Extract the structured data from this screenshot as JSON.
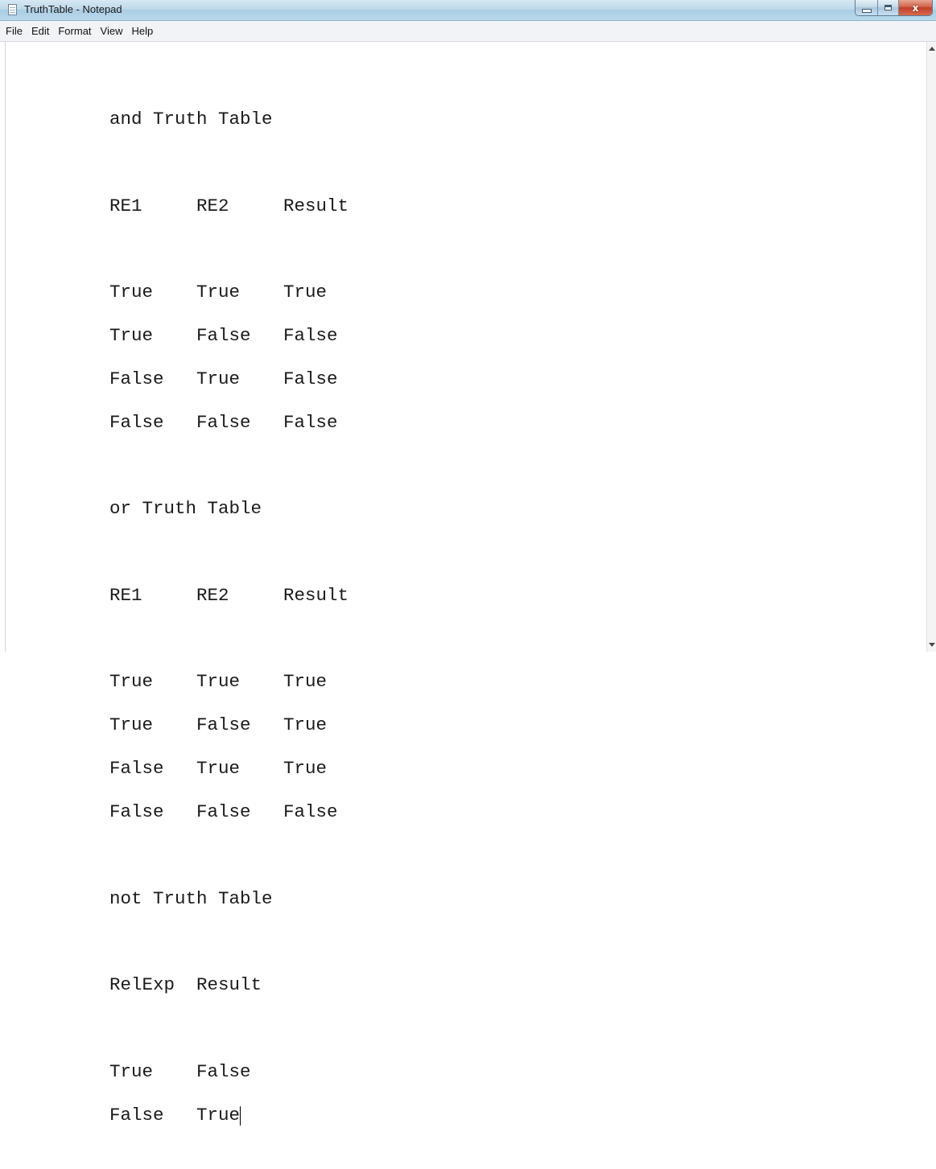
{
  "window": {
    "title": "TruthTable - Notepad",
    "close_glyph": "x"
  },
  "menu": [
    "File",
    "Edit",
    "Format",
    "View",
    "Help"
  ],
  "document": {
    "lines": [
      "and Truth Table",
      "",
      "RE1     RE2     Result",
      "",
      "True    True    True",
      "True    False   False",
      "False   True    False",
      "False   False   False",
      "",
      "or Truth Table",
      "",
      "RE1     RE2     Result",
      "",
      "True    True    True",
      "True    False   True",
      "False   True    True",
      "False   False   False",
      "",
      "not Truth Table",
      "",
      "RelExp  Result",
      "",
      "True    False",
      "False   True"
    ]
  },
  "colors": {
    "titlebar": "#bfd9ea",
    "close_button": "#c9452c",
    "text": "#1a1a1a"
  },
  "icons": [
    "notepad-app-icon",
    "minimize-icon",
    "maximize-icon",
    "close-icon",
    "scroll-up-arrow-icon",
    "scroll-down-arrow-icon"
  ]
}
